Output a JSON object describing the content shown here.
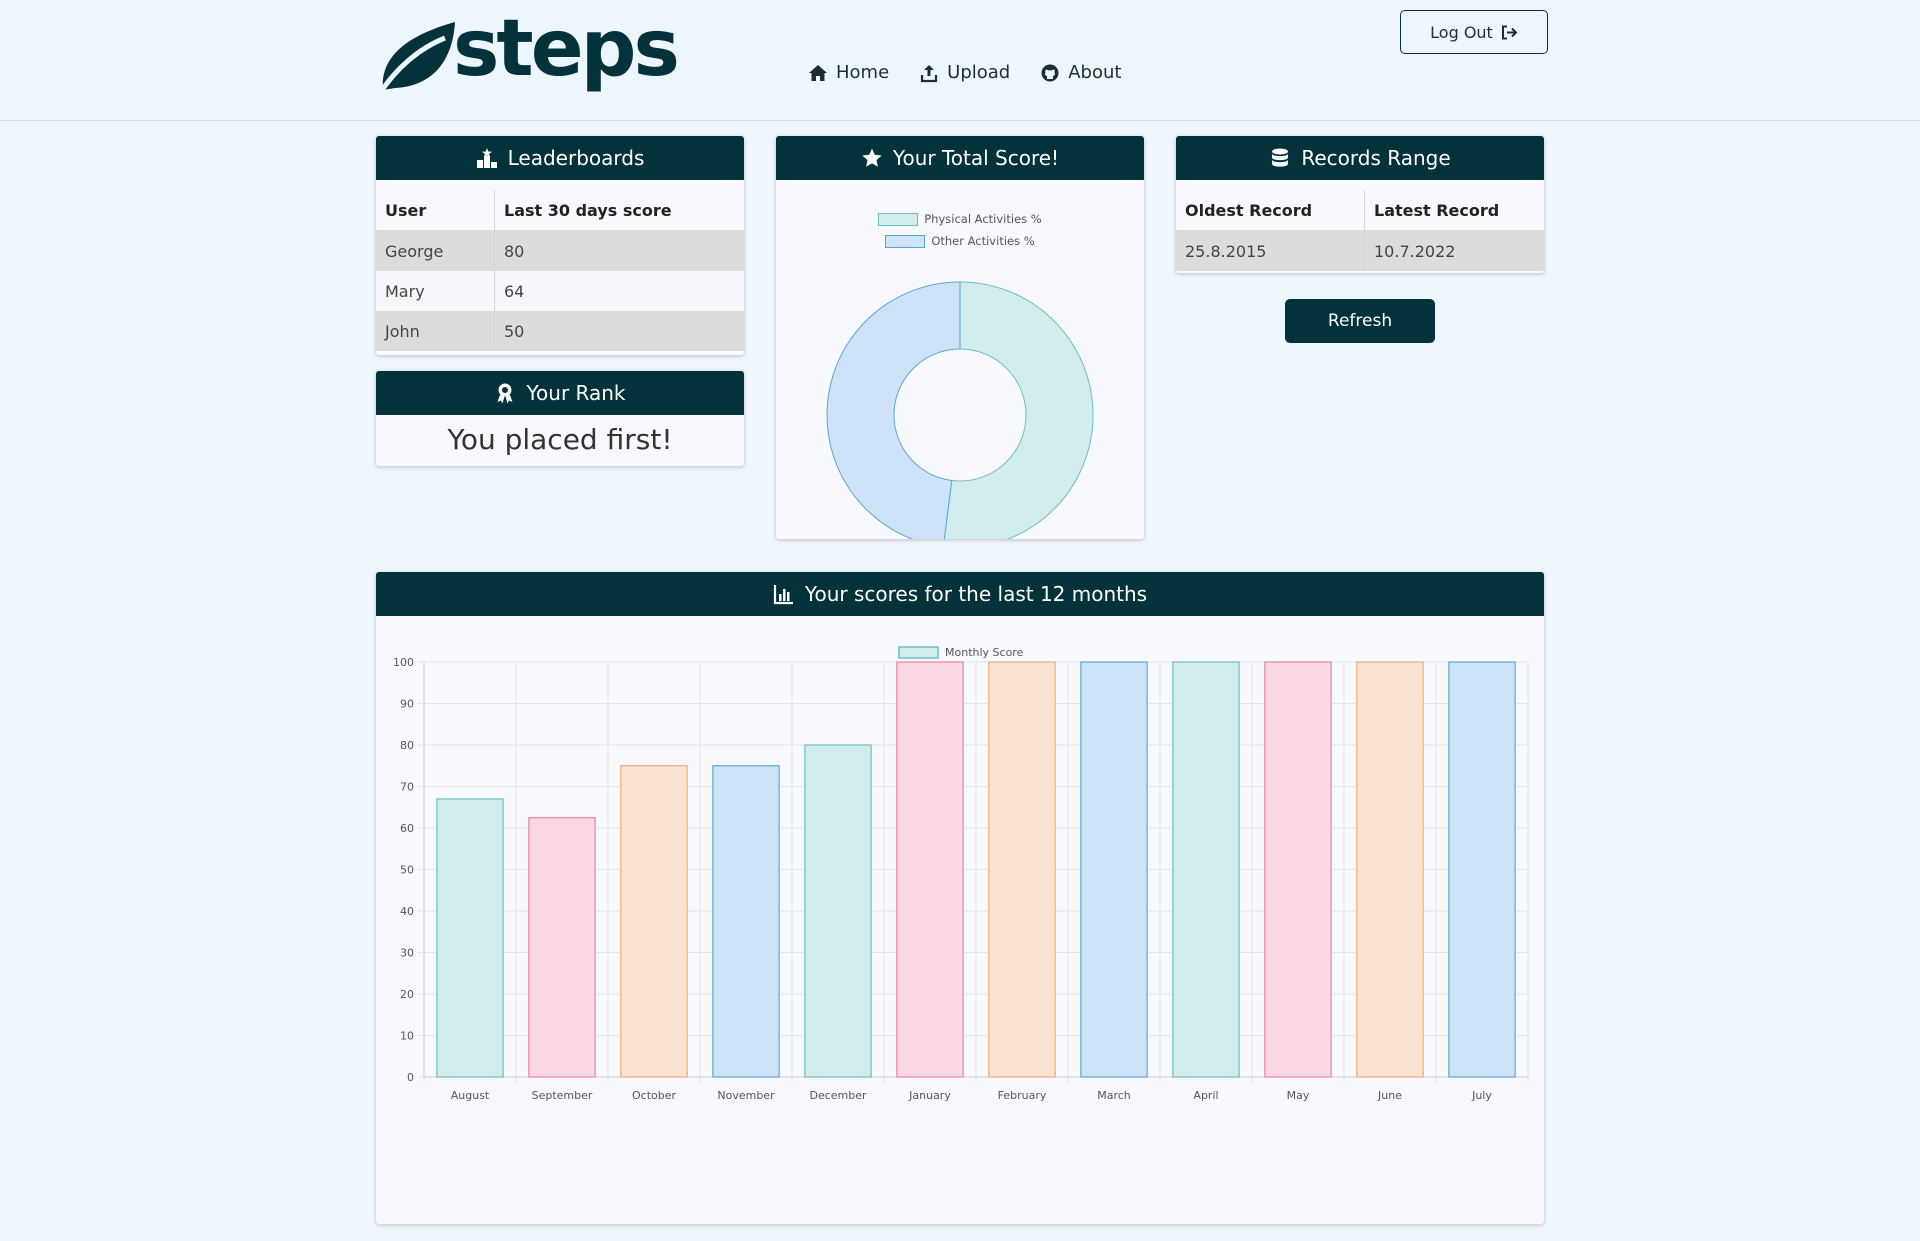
{
  "app": {
    "logo_text": "steps"
  },
  "nav": {
    "home": "Home",
    "upload": "Upload",
    "about": "About",
    "logout": "Log Out"
  },
  "leaderboard": {
    "title": "Leaderboards",
    "headers": [
      "User",
      "Last 30 days score"
    ],
    "rows": [
      {
        "user": "George",
        "score": "80"
      },
      {
        "user": "Mary",
        "score": "64"
      },
      {
        "user": "John",
        "score": "50"
      }
    ]
  },
  "rank": {
    "title": "Your Rank",
    "message": "You placed first!"
  },
  "total_score": {
    "title": "Your Total Score!",
    "legend": [
      "Physical Activities %",
      "Other Activities %"
    ]
  },
  "records": {
    "title": "Records Range",
    "headers": [
      "Oldest Record",
      "Latest Record"
    ],
    "oldest": "25.8.2015",
    "latest": "10.7.2022",
    "refresh_label": "Refresh"
  },
  "monthly": {
    "title": "Your scores for the last 12 months",
    "legend": "Monthly Score"
  },
  "colors": {
    "brand": "#03323a",
    "teal_fill": "#d3ecee",
    "teal_stroke": "#6cbfc2",
    "pink_fill": "#fbd9e4",
    "pink_stroke": "#e8809f",
    "orange_fill": "#f9e4d4",
    "orange_stroke": "#efad74",
    "blue_fill": "#cfe3f8",
    "blue_stroke": "#5aa6d6"
  },
  "chart_data": [
    {
      "type": "pie",
      "legend_position": "top",
      "labels": [
        "Physical Activities %",
        "Other Activities %"
      ],
      "values": [
        52,
        48
      ]
    },
    {
      "type": "bar",
      "legend_position": "top",
      "series": [
        {
          "name": "Monthly Score",
          "values": [
            67,
            62.5,
            75,
            75,
            80,
            100,
            100,
            100,
            100,
            100,
            100,
            100
          ]
        }
      ],
      "categories": [
        "August",
        "September",
        "October",
        "November",
        "December",
        "January",
        "February",
        "March",
        "April",
        "May",
        "June",
        "July"
      ],
      "ylim": [
        0,
        100
      ],
      "yticks": [
        0,
        10,
        20,
        30,
        40,
        50,
        60,
        70,
        80,
        90,
        100
      ],
      "grid": true
    }
  ]
}
